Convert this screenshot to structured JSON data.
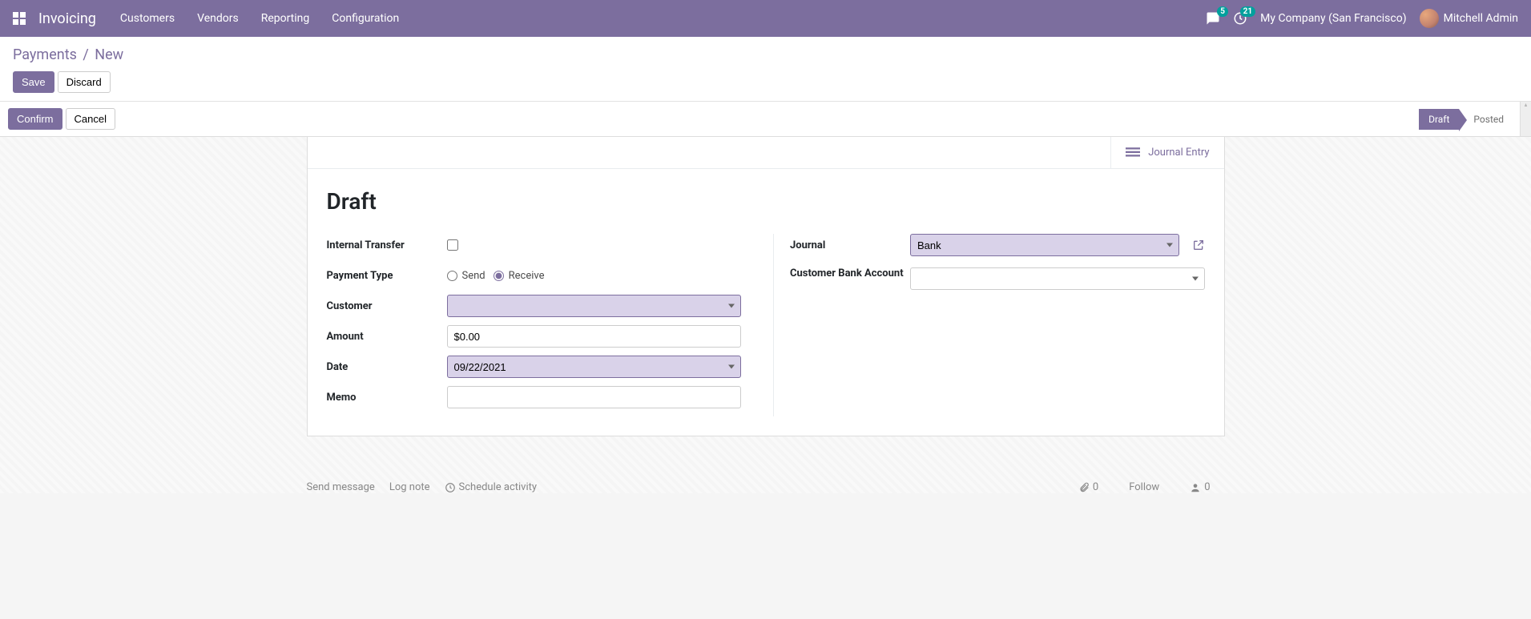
{
  "navbar": {
    "brand": "Invoicing",
    "menu": [
      "Customers",
      "Vendors",
      "Reporting",
      "Configuration"
    ],
    "messages_badge": "5",
    "activities_badge": "21",
    "company": "My Company (San Francisco)",
    "user": "Mitchell Admin"
  },
  "breadcrumb": {
    "root": "Payments",
    "current": "New"
  },
  "cp": {
    "save": "Save",
    "discard": "Discard"
  },
  "statusbar": {
    "confirm": "Confirm",
    "cancel": "Cancel",
    "stages": {
      "draft": "Draft",
      "posted": "Posted"
    }
  },
  "stat": {
    "journal_entry": "Journal Entry"
  },
  "title": "Draft",
  "left": {
    "internal_transfer_label": "Internal Transfer",
    "internal_transfer_checked": false,
    "payment_type_label": "Payment Type",
    "send": "Send",
    "receive": "Receive",
    "customer_label": "Customer",
    "customer_value": "",
    "amount_label": "Amount",
    "amount_value": "$0.00",
    "date_label": "Date",
    "date_value": "09/22/2021",
    "memo_label": "Memo",
    "memo_value": ""
  },
  "right": {
    "journal_label": "Journal",
    "journal_value": "Bank",
    "cust_bank_label": "Customer Bank Account",
    "cust_bank_value": ""
  },
  "chatter": {
    "send_message": "Send message",
    "log_note": "Log note",
    "schedule": "Schedule activity",
    "attach_count": "0",
    "follow": "Follow",
    "follower_count": "0"
  }
}
